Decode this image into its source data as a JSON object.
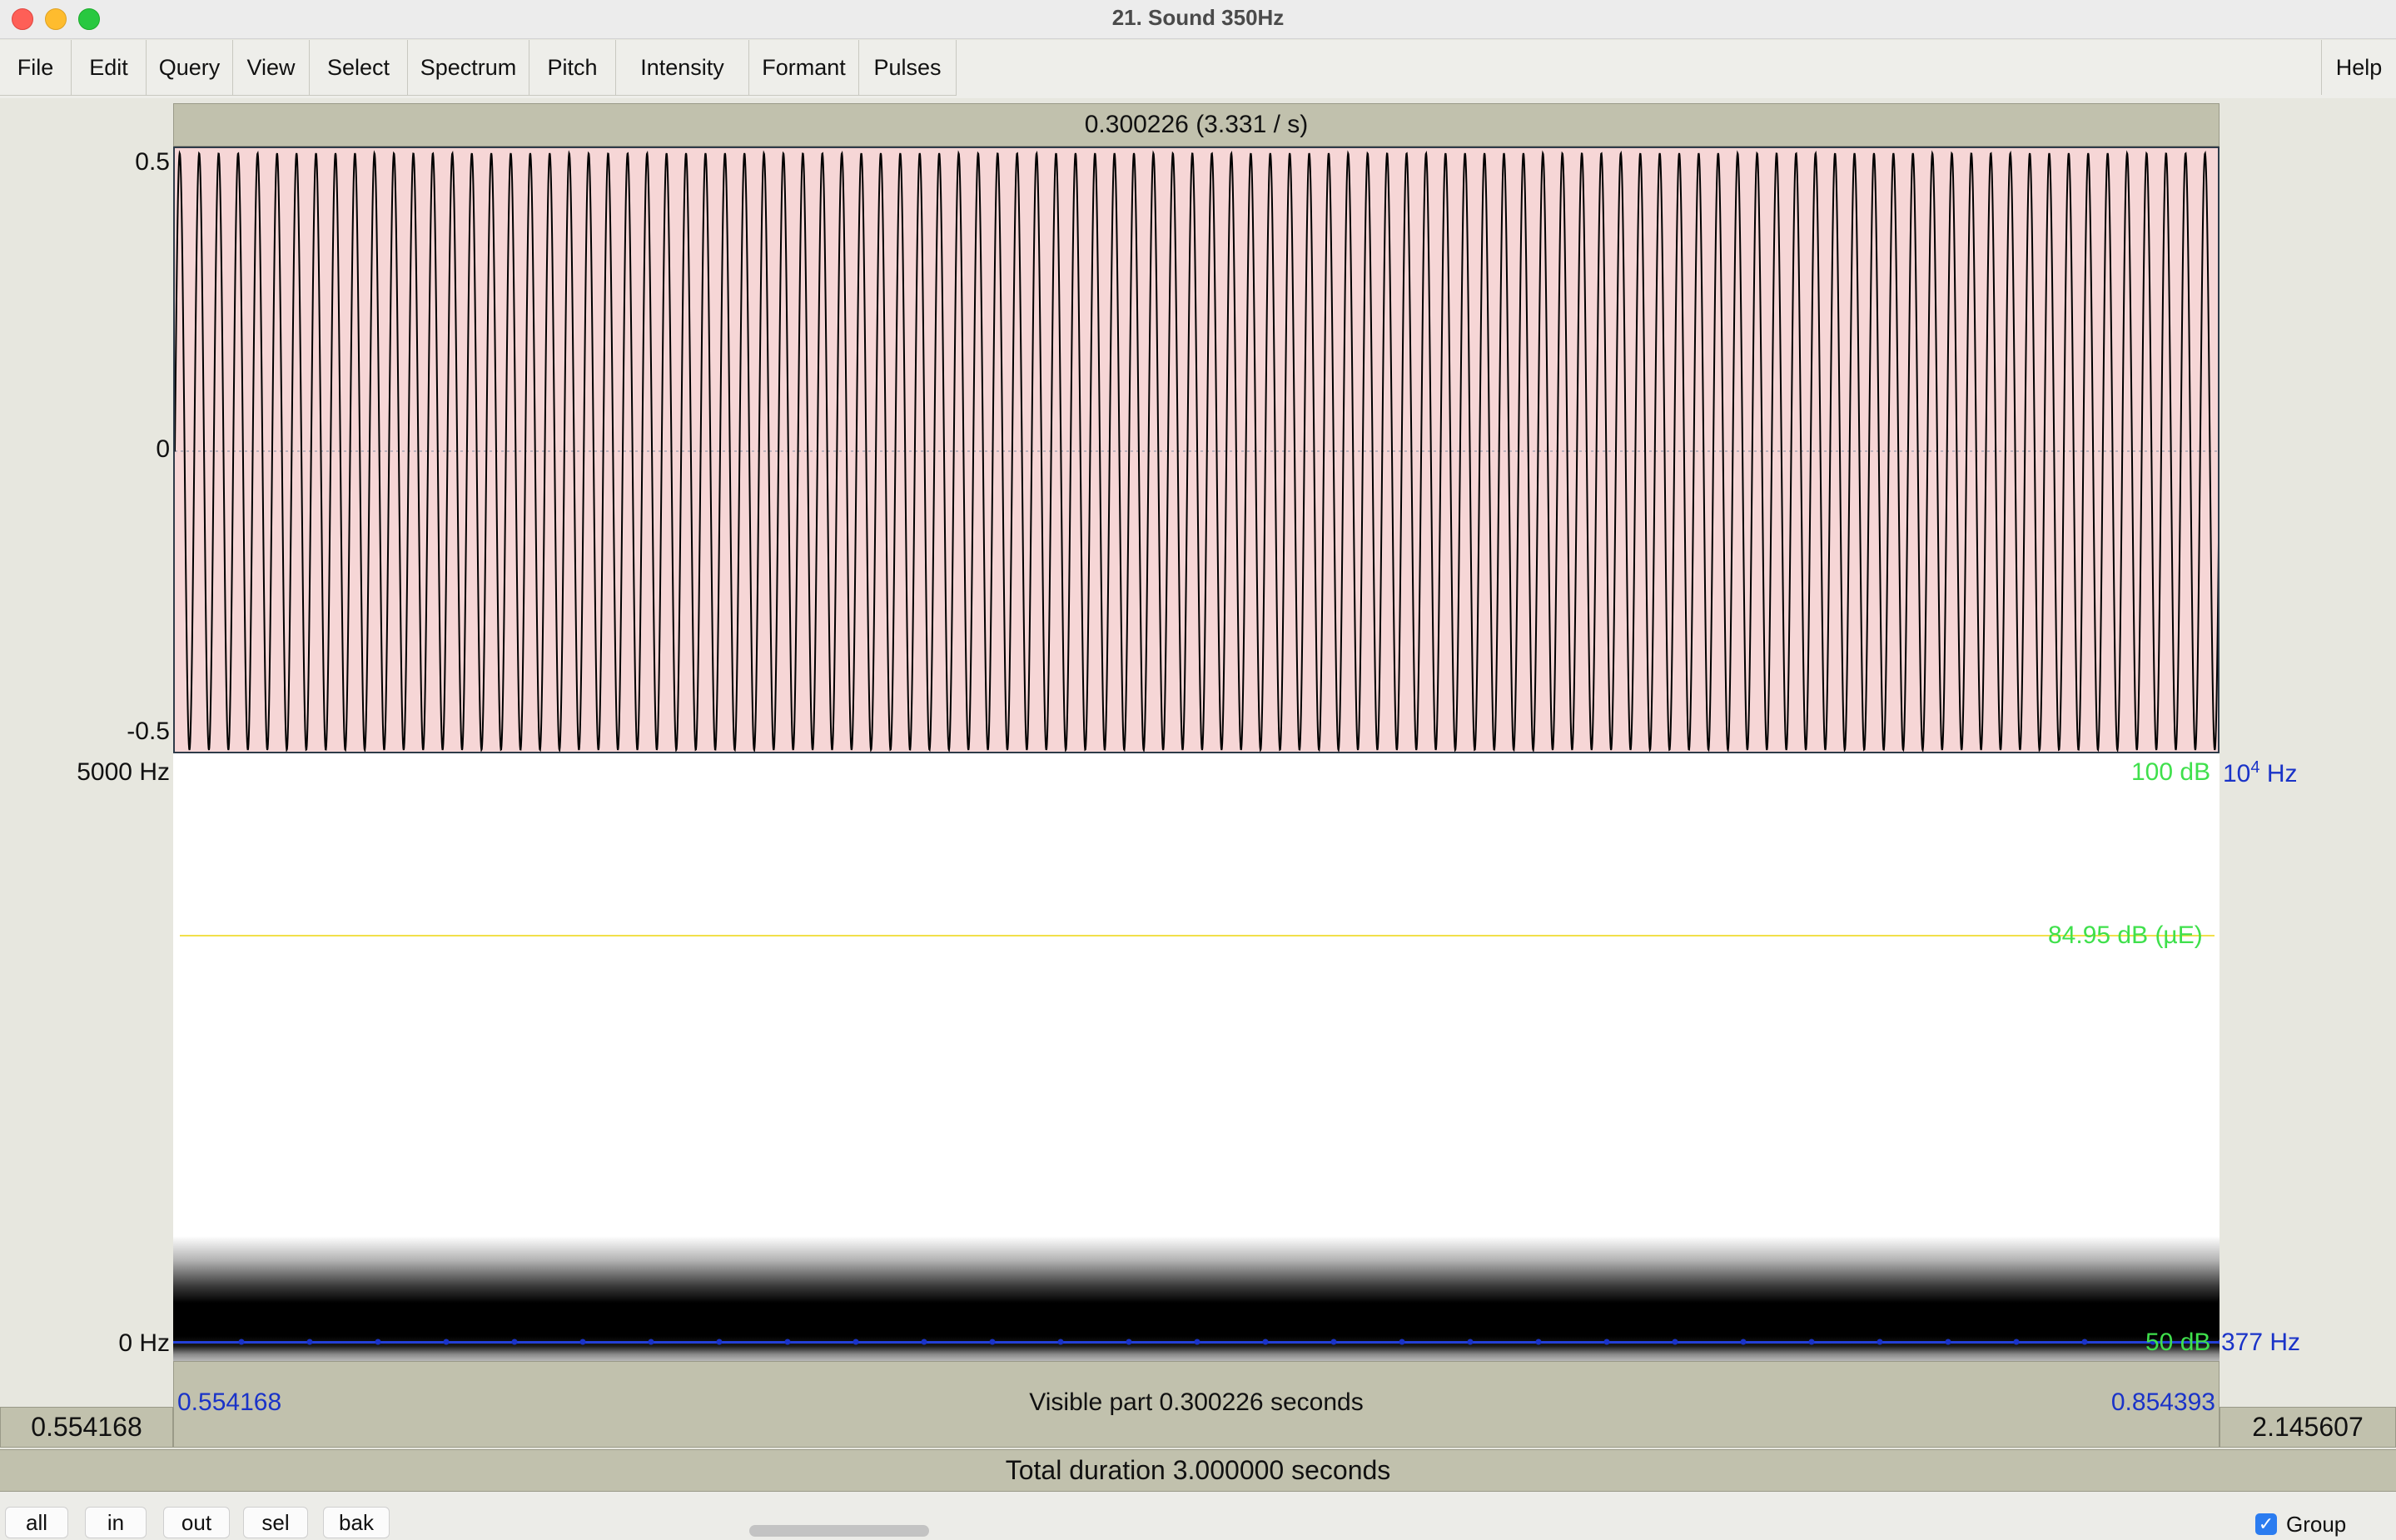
{
  "window": {
    "title": "21. Sound 350Hz"
  },
  "menu": {
    "items": [
      "File",
      "Edit",
      "Query",
      "View",
      "Select",
      "Spectrum",
      "Pitch",
      "Intensity",
      "Formant",
      "Pulses"
    ],
    "help": "Help"
  },
  "top_info": "0.300226 (3.331 / s)",
  "waveform": {
    "y_max_label": "0.5",
    "y_zero_label": "0",
    "y_min_label": "-0.5",
    "frequency_hz": 350,
    "fill_color": "#f6d6d6"
  },
  "spectrogram": {
    "top_freq_label": "5000 Hz",
    "bottom_freq_label": "0 Hz"
  },
  "intensity": {
    "max_label": "100 dB",
    "min_label": "50 dB",
    "current_label": "84.95 dB (µE)",
    "color": "#3fe04c"
  },
  "pitch": {
    "top_base": "10",
    "top_exp": "4",
    "top_unit": " Hz",
    "current_label": "377 Hz",
    "color": "#1a33c8"
  },
  "selection": {
    "start": "0.554168",
    "end": "0.854393",
    "visible_part": "Visible part 0.300226 seconds"
  },
  "window_range": {
    "left": "0.554168",
    "right": "2.145607"
  },
  "total_duration": "Total duration 3.000000 seconds",
  "zoom_buttons": [
    "all",
    "in",
    "out",
    "sel",
    "bak"
  ],
  "group": {
    "checked": true,
    "label": "Group"
  }
}
